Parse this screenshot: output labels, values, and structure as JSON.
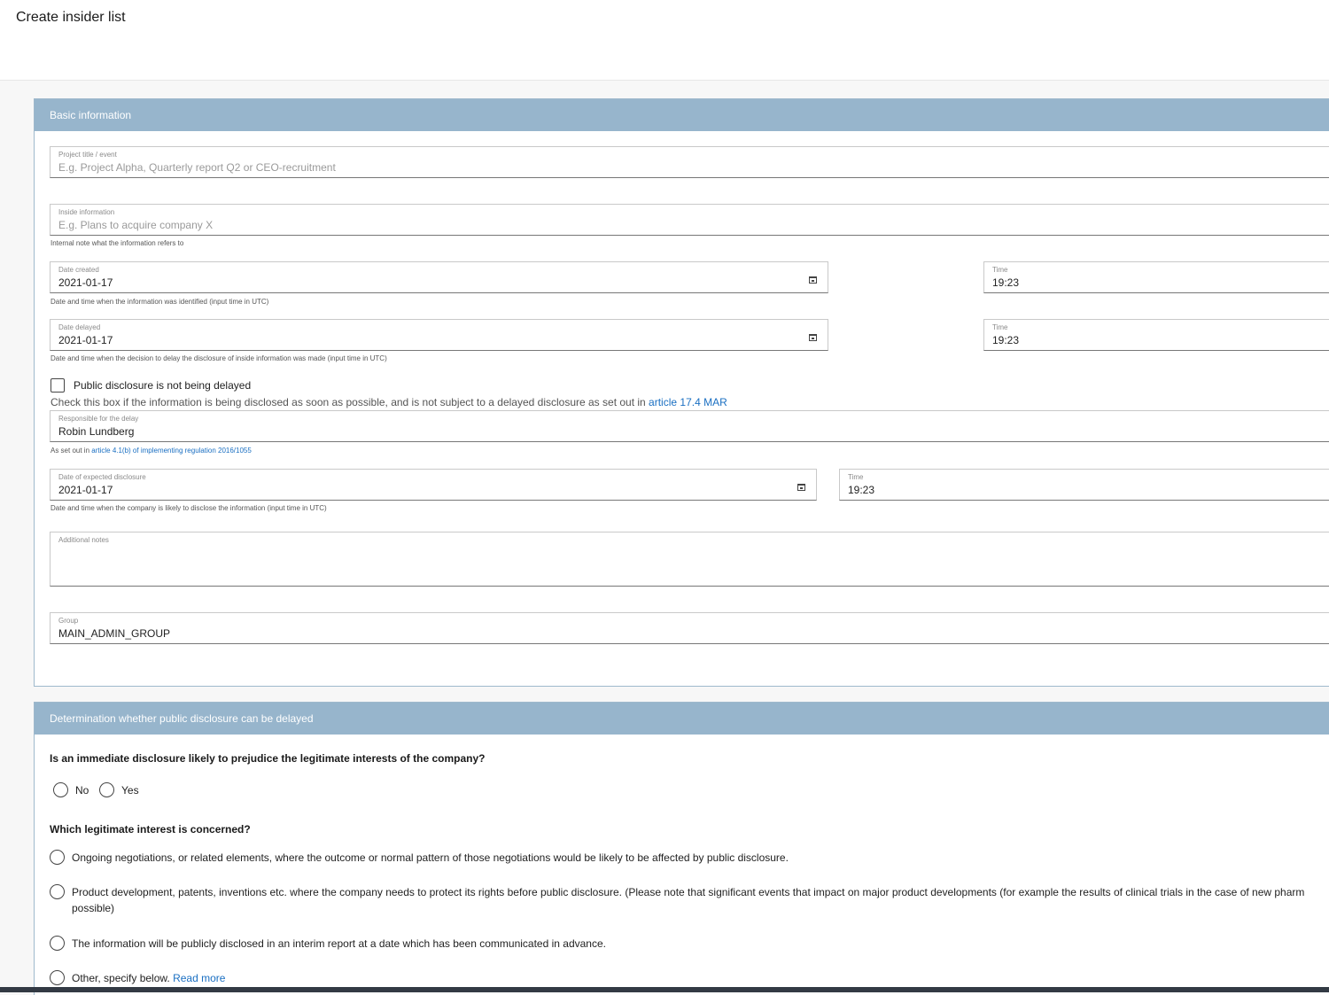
{
  "page": {
    "title": "Create insider list"
  },
  "basic": {
    "header": "Basic information",
    "project": {
      "label": "Project title / event",
      "placeholder": "E.g. Project Alpha, Quarterly report Q2 or CEO-recruitment"
    },
    "inside": {
      "label": "Inside information",
      "placeholder": "E.g. Plans to acquire company X",
      "helper": "Internal note what the information refers to"
    },
    "created": {
      "date_label": "Date created",
      "date": "2021-01-17",
      "time_label": "Time",
      "time": "19:23",
      "helper": "Date and time when the information was identified (input time in UTC)"
    },
    "delayed": {
      "date_label": "Date delayed",
      "date": "2021-01-17",
      "time_label": "Time",
      "time": "19:23",
      "helper": "Date and time when the decision to delay the disclosure of inside information was made (input time in UTC)"
    },
    "not_delayed": {
      "label": "Public disclosure is not being delayed",
      "desc": "Check this box if the information is being disclosed as soon as possible, and is not subject to a delayed disclosure as set out in ",
      "link": "article 17.4 MAR"
    },
    "responsible": {
      "label": "Responsible for the delay",
      "value": "Robin Lundberg",
      "helper_prefix": "As set out in ",
      "helper_link": "article 4.1(b) of implementing regulation 2016/1055"
    },
    "expected": {
      "date_label": "Date of expected disclosure",
      "date": "2021-01-17",
      "time_label": "Time",
      "time": "19:23",
      "helper": "Date and time when the company is likely to disclose the information (input time in UTC)"
    },
    "notes": {
      "label": "Additional notes",
      "value": ""
    },
    "group": {
      "label": "Group",
      "value": "MAIN_ADMIN_GROUP"
    }
  },
  "determination": {
    "header": "Determination whether public disclosure can be delayed",
    "q1": "Is an immediate disclosure likely to prejudice the legitimate interests of the company?",
    "q1_options": [
      "No",
      "Yes"
    ],
    "q2": "Which legitimate interest is concerned?",
    "q2_options": [
      "Ongoing negotiations, or related elements, where the outcome or normal pattern of those negotiations would be likely to be affected by public disclosure.",
      "Product development, patents, inventions etc. where the company needs to protect its rights before public disclosure. (Please note that significant events that impact on major product developments (for example the results of clinical trials in the case of new pharm",
      "possible)",
      "The information will be publicly disclosed in an interim report at a date which has been communicated in advance.",
      "Other, specify below.",
      "Read more"
    ]
  }
}
